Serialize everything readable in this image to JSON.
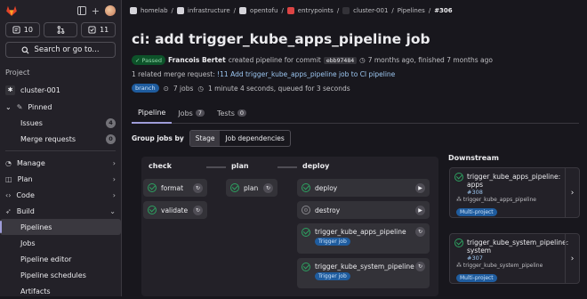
{
  "sidebar": {
    "counts": {
      "issues": "10",
      "merge_requests": "",
      "todos": "11"
    },
    "search_label": "Search or go to...",
    "section_label": "Project",
    "project_name": "cluster-001",
    "items": {
      "pinned": "Pinned",
      "issues": "Issues",
      "issues_count": "4",
      "merge_requests": "Merge requests",
      "merge_requests_count": "0",
      "manage": "Manage",
      "plan": "Plan",
      "code": "Code",
      "build": "Build",
      "pipelines": "Pipelines",
      "jobs": "Jobs",
      "pipeline_editor": "Pipeline editor",
      "pipeline_schedules": "Pipeline schedules",
      "artifacts": "Artifacts"
    }
  },
  "breadcrumb": [
    "homelab",
    "infrastructure",
    "opentofu",
    "entrypoints",
    "cluster-001",
    "Pipelines",
    "#306"
  ],
  "pipeline": {
    "title": "ci: add trigger_kube_apps_pipeline job",
    "status": "Passed",
    "author": "Francois Bertet",
    "created_text": "created pipeline for commit",
    "commit": "ebb97484",
    "time_text": "7 months ago, finished 7 months ago",
    "mr_prefix": "1 related merge request:",
    "mr_link": "!11 Add trigger_kube_apps_pipeline job to CI pipeline",
    "branch_badge": "branch",
    "jobs_count_text": "7 jobs",
    "duration_text": "1 minute 4 seconds, queued for 3 seconds"
  },
  "tabs": [
    {
      "label": "Pipeline",
      "count": ""
    },
    {
      "label": "Jobs",
      "count": "7"
    },
    {
      "label": "Tests",
      "count": "0"
    }
  ],
  "group_jobs": {
    "label": "Group jobs by",
    "options": [
      "Stage",
      "Job dependencies"
    ],
    "selected": "Stage"
  },
  "stages": {
    "check": {
      "name": "check",
      "jobs": [
        "format",
        "validate"
      ]
    },
    "plan": {
      "name": "plan",
      "jobs": [
        "plan"
      ]
    },
    "deploy": {
      "name": "deploy",
      "jobs": [
        "deploy",
        "destroy",
        "trigger_kube_apps_pipeline",
        "trigger_kube_system_pipeline"
      ]
    },
    "trigger_label": "Trigger job"
  },
  "downstream": {
    "title": "Downstream",
    "cards": [
      {
        "name": "trigger_kube_apps_pipeline: apps",
        "id": "#308",
        "project": "trigger_kube_apps_pipeline",
        "badge": "Multi-project"
      },
      {
        "name": "trigger_kube_system_pipeline: system",
        "id": "#307",
        "project": "trigger_kube_system_pipeline",
        "badge": "Multi-project"
      }
    ]
  },
  "colors": {
    "success": "#2da160",
    "accent": "#9e9cd8",
    "link": "#9dc7f1"
  },
  "icons": [
    "gitlab-logo-icon",
    "sidebar-toggle-icon",
    "plus-icon",
    "issues-icon",
    "merge-request-icon",
    "todo-icon",
    "search-icon",
    "pin-icon",
    "gear-icon",
    "play-icon",
    "retry-icon",
    "chevron-right-icon",
    "clock-icon",
    "pipeline-icon"
  ]
}
